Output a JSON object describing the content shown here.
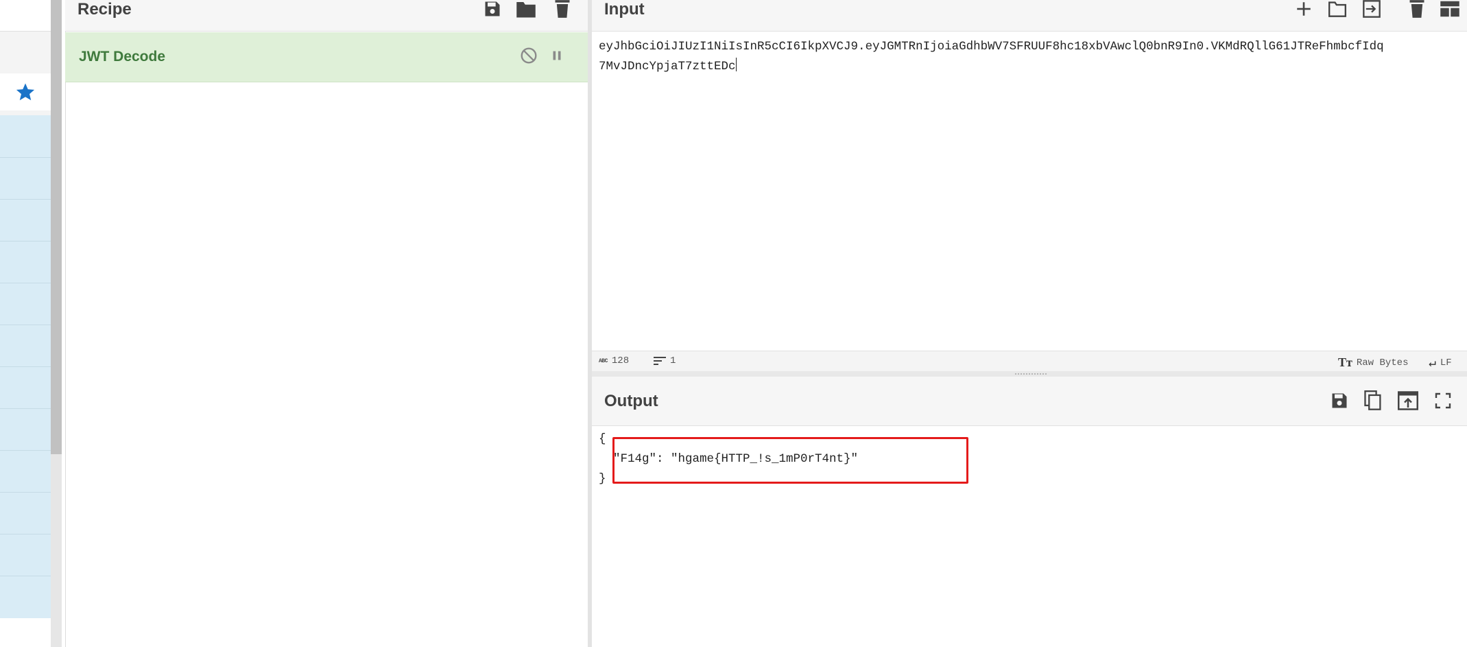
{
  "recipe": {
    "title": "Recipe",
    "operations": [
      {
        "name": "JWT Decode"
      }
    ]
  },
  "input": {
    "title": "Input",
    "line1": "eyJhbGciOiJIUzI1NiIsInR5cCI6IkpXVCJ9.eyJGMTRnIjoiaGdhbWV7SFRUUF8hc18xbVAwclQ0bnR9In0.VKMdRQllG61JTReFhmbcfIdq",
    "line2": "7MvJDncYpjaT7zttEDc",
    "stats": {
      "length": "128",
      "lines": "1",
      "encoding": "Raw Bytes",
      "eol": "LF"
    },
    "length_badge": "ABC"
  },
  "output": {
    "title": "Output",
    "open_brace": "{",
    "line": "  \"F14g\": \"hgame{HTTP_!s_1mP0rT4nt}\"",
    "close_brace": "}"
  },
  "colors": {
    "op_card_bg": "#dff0d8",
    "op_name": "#3f7a3d",
    "favourite_star": "#1a73c8",
    "ops_list_bg": "#d9ecf6",
    "highlight_box": "#e41b1b"
  },
  "icons": {
    "recipe_toolbar": [
      "save-icon",
      "folder-icon",
      "trash-icon"
    ],
    "op_controls": [
      "disable-icon",
      "pause-icon"
    ],
    "input_toolbar": [
      "plus-icon",
      "folder-icon",
      "input-arrow-icon",
      "trash-icon",
      "layout-icon"
    ],
    "output_toolbar": [
      "save-icon",
      "copy-icon",
      "replace-input-icon",
      "maximize-icon"
    ],
    "favourite": "star-icon"
  }
}
